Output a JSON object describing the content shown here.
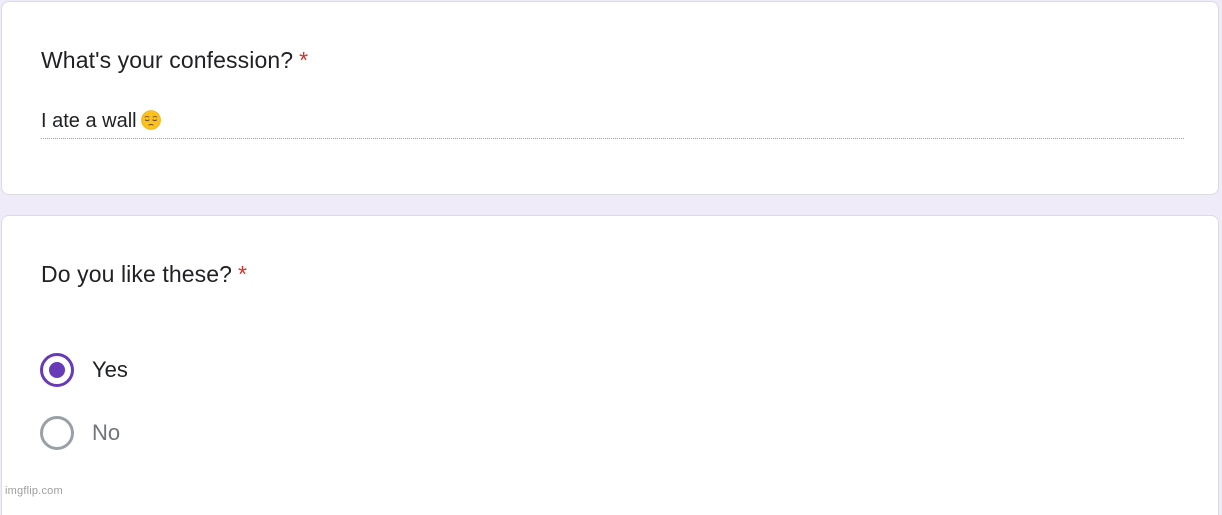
{
  "q1": {
    "title": "What's your confession?",
    "required_mark": "*",
    "answer": "I ate a wall",
    "answer_emoji": "pensive-face-icon"
  },
  "q2": {
    "title": "Do you like these?",
    "required_mark": "*",
    "options": [
      {
        "label": "Yes",
        "selected": true
      },
      {
        "label": "No",
        "selected": false
      }
    ]
  },
  "watermark": "imgflip.com",
  "colors": {
    "page_bg": "#f0ebf8",
    "accent": "#673ab7",
    "required": "#d93025"
  }
}
